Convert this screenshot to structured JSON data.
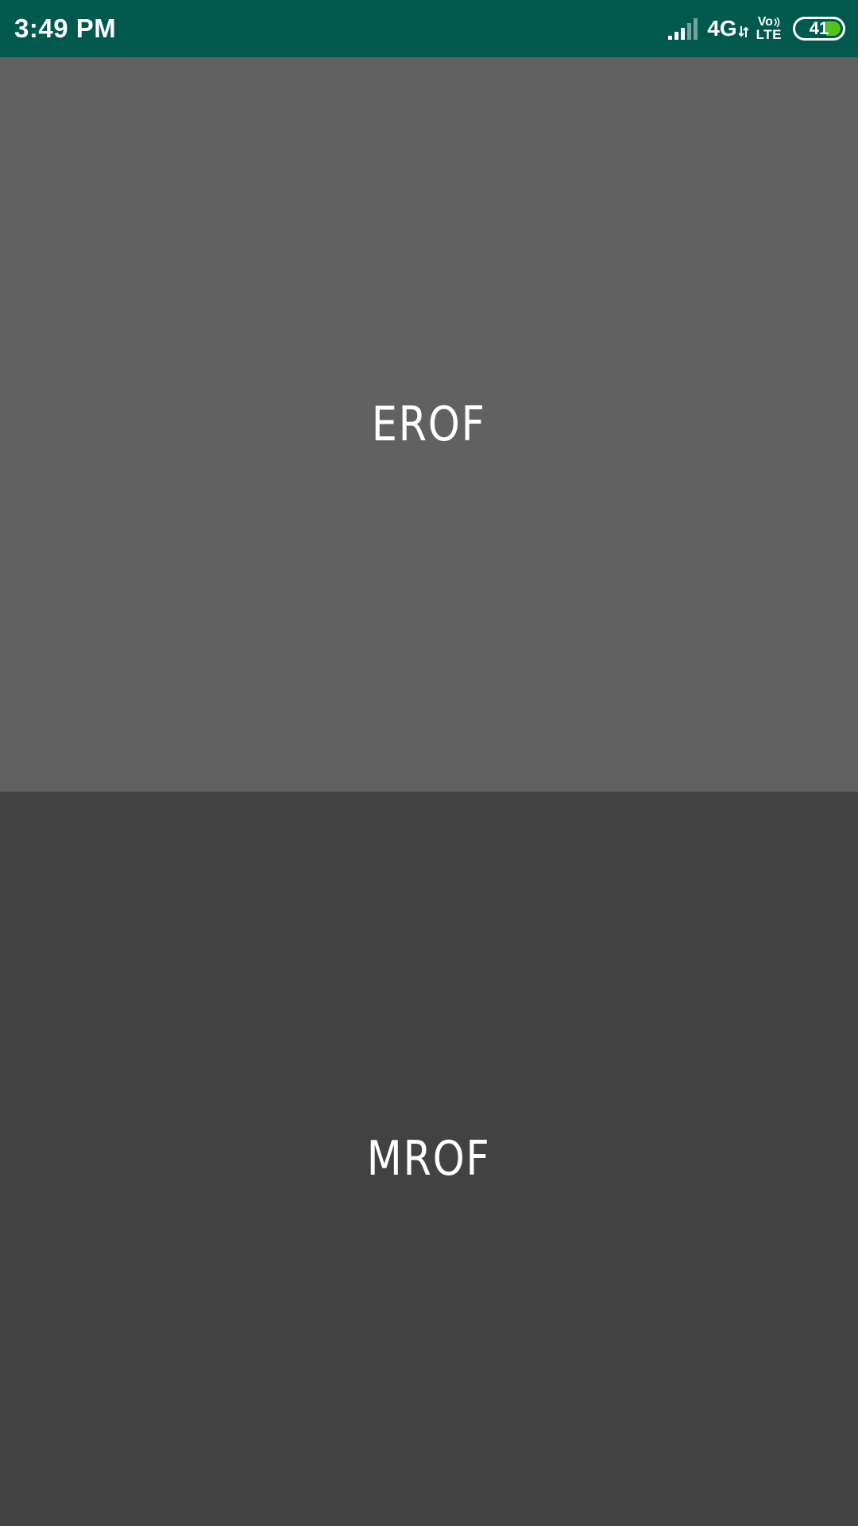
{
  "status_bar": {
    "time": "3:49 PM",
    "network": "4G",
    "volte_top": "Vo",
    "volte_bottom": "LTE",
    "battery_level": "41",
    "bg_color": "#00594C",
    "battery_color": "#52C41A",
    "icons": [
      "signal-icon",
      "data-arrows-icon",
      "volte-wave-icon",
      "battery-icon"
    ]
  },
  "panels": [
    {
      "label": "EROF",
      "color": "#616161"
    },
    {
      "label": "MROF",
      "color": "#424242"
    }
  ]
}
